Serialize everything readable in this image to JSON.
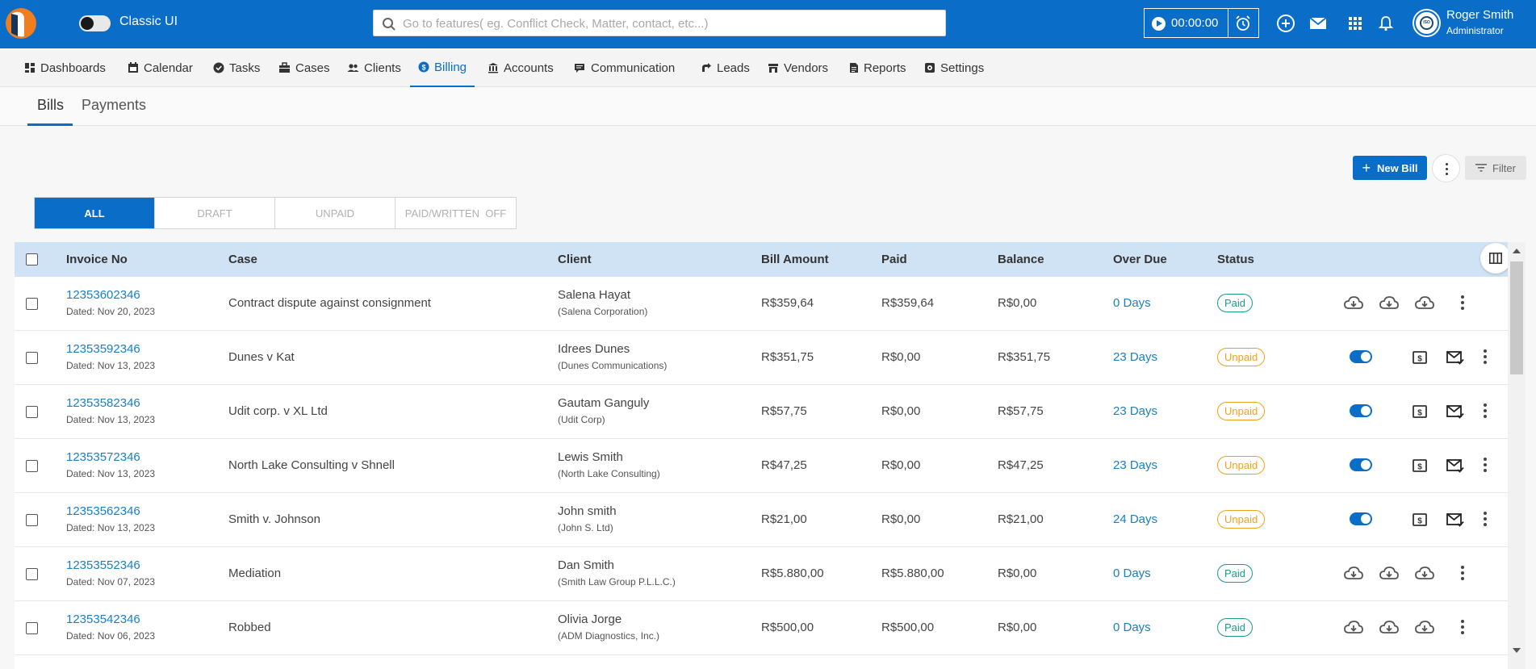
{
  "header": {
    "classic_ui_label": "Classic UI",
    "search_placeholder": "Go to features( eg. Conflict Check, Matter, contact, etc...)",
    "timer": "00:00:00",
    "user_name": "Roger Smith",
    "user_role": "Administrator",
    "avatar_badge": "ISO",
    "brand_color": "#0a6ec9"
  },
  "nav": {
    "items": [
      {
        "label": "Dashboards",
        "icon": "dashboard-icon"
      },
      {
        "label": "Calendar",
        "icon": "calendar-icon"
      },
      {
        "label": "Tasks",
        "icon": "check-circle-icon"
      },
      {
        "label": "Cases",
        "icon": "briefcase-icon"
      },
      {
        "label": "Clients",
        "icon": "users-icon"
      },
      {
        "label": "Billing",
        "icon": "dollar-circle-icon"
      },
      {
        "label": "Accounts",
        "icon": "bank-icon"
      },
      {
        "label": "Communication",
        "icon": "chat-icon"
      },
      {
        "label": "Leads",
        "icon": "leads-icon"
      },
      {
        "label": "Vendors",
        "icon": "store-icon"
      },
      {
        "label": "Reports",
        "icon": "report-icon"
      },
      {
        "label": "Settings",
        "icon": "settings-icon"
      }
    ],
    "active": "Billing"
  },
  "subtabs": [
    "Bills",
    "Payments"
  ],
  "actions": {
    "new_bill": "New Bill",
    "filter": "Filter"
  },
  "segments": [
    "ALL",
    "DRAFT",
    "UNPAID",
    "PAID/WRITTEN  OFF"
  ],
  "table": {
    "columns": [
      "Invoice No",
      "Case",
      "Client",
      "Bill Amount",
      "Paid",
      "Balance",
      "Over Due",
      "Status"
    ],
    "rows": [
      {
        "invoice": "12353602346",
        "date": "Dated: Nov 20, 2023",
        "case": "Contract dispute against consignment",
        "client": "Salena Hayat",
        "org": "(Salena Corporation)",
        "amount": "R$359,64",
        "paid": "R$359,64",
        "balance": "R$0,00",
        "overdue": "0 Days",
        "status": "Paid"
      },
      {
        "invoice": "12353592346",
        "date": "Dated: Nov 13, 2023",
        "case": "Dunes v Kat",
        "client": "Idrees Dunes",
        "org": "(Dunes Communications)",
        "amount": "R$351,75",
        "paid": "R$0,00",
        "balance": "R$351,75",
        "overdue": "23 Days",
        "status": "Unpaid"
      },
      {
        "invoice": "12353582346",
        "date": "Dated: Nov 13, 2023",
        "case": "Udit corp. v XL Ltd",
        "client": "Gautam Ganguly",
        "org": "(Udit Corp)",
        "amount": "R$57,75",
        "paid": "R$0,00",
        "balance": "R$57,75",
        "overdue": "23 Days",
        "status": "Unpaid"
      },
      {
        "invoice": "12353572346",
        "date": "Dated: Nov 13, 2023",
        "case": "North Lake Consulting v Shnell",
        "client": "Lewis Smith",
        "org": "(North Lake Consulting)",
        "amount": "R$47,25",
        "paid": "R$0,00",
        "balance": "R$47,25",
        "overdue": "23 Days",
        "status": "Unpaid"
      },
      {
        "invoice": "12353562346",
        "date": "Dated: Nov 13, 2023",
        "case": "Smith v. Johnson",
        "client": "John smith",
        "org": "(John S. Ltd)",
        "amount": "R$21,00",
        "paid": "R$0,00",
        "balance": "R$21,00",
        "overdue": "24 Days",
        "status": "Unpaid"
      },
      {
        "invoice": "12353552346",
        "date": "Dated: Nov 07, 2023",
        "case": "Mediation",
        "client": "Dan Smith",
        "org": "(Smith Law Group P.L.L.C.)",
        "amount": "R$5.880,00",
        "paid": "R$5.880,00",
        "balance": "R$0,00",
        "overdue": "0 Days",
        "status": "Paid"
      },
      {
        "invoice": "12353542346",
        "date": "Dated: Nov 06, 2023",
        "case": "Robbed",
        "client": "Olivia Jorge",
        "org": "(ADM Diagnostics, Inc.)",
        "amount": "R$500,00",
        "paid": "R$500,00",
        "balance": "R$0,00",
        "overdue": "0 Days",
        "status": "Paid"
      }
    ]
  },
  "colors": {
    "paid": "#1e9a8a",
    "unpaid": "#f0a21a",
    "link": "#1a7fc4"
  }
}
